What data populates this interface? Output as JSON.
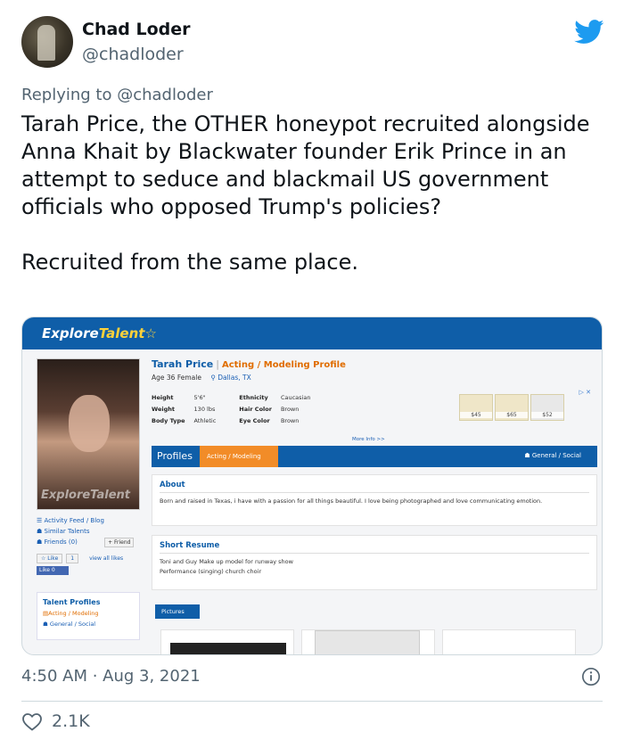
{
  "author": {
    "name": "Chad Loder",
    "handle": "@chadloder"
  },
  "reply": {
    "prefix": "Replying to",
    "mention": "@chadloder"
  },
  "tweet": {
    "paragraph1": "Tarah Price, the OTHER honeypot recruited alongside Anna Khait by Blackwater founder Erik Prince in an attempt to seduce and blackmail US government officials who opposed Trump's policies?",
    "paragraph2": "Recruited from the same place."
  },
  "screenshot": {
    "logo_explore": "Explore",
    "logo_talent": "Talent",
    "photo_watermark": "ExploreTalent",
    "links": {
      "activity_feed": "Activity Feed / Blog",
      "similar_talents": "Similar Talents",
      "friends": "Friends (0)",
      "add_friend": "+ Friend",
      "like": "Like",
      "like_count": "1",
      "view_all_likes": "view all likes",
      "fb_like": "Like 0"
    },
    "talent_profiles": {
      "title": "Talent Profiles",
      "item1": "Acting / Modeling",
      "item2": "General / Social"
    },
    "profile": {
      "name": "Tarah Price",
      "type": "Acting / Modeling Profile",
      "age_gender": "Age 36 Female",
      "location": "Dallas, TX",
      "height_label": "Height",
      "height": "5'6\"",
      "weight_label": "Weight",
      "weight": "130 lbs",
      "body_label": "Body Type",
      "body": "Athletic",
      "ethnicity_label": "Ethnicity",
      "ethnicity": "Caucasian",
      "hair_label": "Hair Color",
      "hair": "Brown",
      "eye_label": "Eye Color",
      "eye": "Brown",
      "more_info": "More Info >>"
    },
    "ad": {
      "price1": "$45",
      "price2": "$65",
      "price3": "$52",
      "close": "▷ ✕"
    },
    "profiles_bar": {
      "title": "Profiles",
      "tab": "Acting / Modeling",
      "right": "General / Social"
    },
    "about": {
      "title": "About",
      "body": "Born and raised in Texas, i have with a passion for all things beautiful. I love being photographed and love communicating emotion."
    },
    "resume": {
      "title": "Short Resume",
      "line1": "Toni and Guy Make up model for runway show",
      "line2": "Performance (singing) church choir"
    },
    "pictures_label": "Pictures"
  },
  "meta": {
    "timestamp": "4:50 AM · Aug 3, 2021",
    "likes": "2.1K"
  },
  "colors": {
    "twitter_blue": "#1d9bf0",
    "et_blue": "#0f5ea8",
    "et_orange": "#f28c28"
  }
}
